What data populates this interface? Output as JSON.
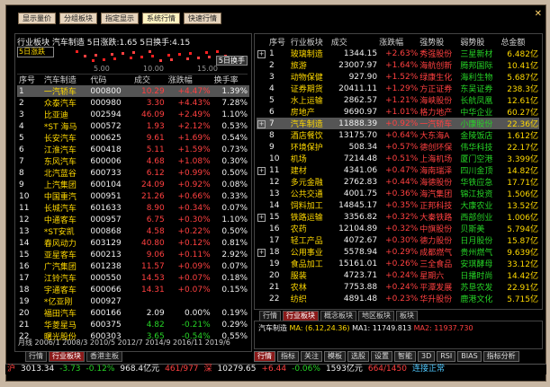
{
  "topbar": {
    "buttons": [
      "显示量价",
      "分组板块",
      "指定显示",
      "系统行情",
      "快速行情"
    ],
    "active_index": 3
  },
  "left": {
    "title": "行业板块 汽车制造 5日涨跌:1.65 5日换手:4.15",
    "mini_box": "5日涨跌",
    "mini_btn": "5日换手",
    "axis_ticks": [
      "5.00",
      "10.00",
      "15.00"
    ],
    "headers": [
      "序号",
      "汽车制造",
      "代码",
      "成交",
      "涨跌幅",
      "换手率"
    ],
    "rows": [
      [
        "1",
        "一汽轿车",
        "000800",
        "10.29",
        "+4.47%",
        "1.39%"
      ],
      [
        "2",
        "众泰汽车",
        "000980",
        "3.30",
        "+4.43%",
        "7.28%"
      ],
      [
        "3",
        "比亚迪",
        "002594",
        "46.09",
        "+2.49%",
        "1.10%"
      ],
      [
        "4",
        "*ST 海马",
        "000572",
        "1.93",
        "+2.12%",
        "0.53%"
      ],
      [
        "5",
        "长安汽车",
        "000625",
        "9.61",
        "+1.69%",
        "0.54%"
      ],
      [
        "6",
        "江淮汽车",
        "600418",
        "5.11",
        "+1.59%",
        "0.73%"
      ],
      [
        "7",
        "东风汽车",
        "600006",
        "4.68",
        "+1.08%",
        "0.30%"
      ],
      [
        "8",
        "北汽蓝谷",
        "600733",
        "6.12",
        "+0.99%",
        "0.50%"
      ],
      [
        "9",
        "上汽集团",
        "600104",
        "24.09",
        "+0.92%",
        "0.08%"
      ],
      [
        "10",
        "中国重汽",
        "000951",
        "21.26",
        "+0.66%",
        "0.33%"
      ],
      [
        "11",
        "长城汽车",
        "601633",
        "8.90",
        "+0.34%",
        "0.07%"
      ],
      [
        "12",
        "中通客车",
        "000957",
        "6.75",
        "+0.30%",
        "1.10%"
      ],
      [
        "13",
        "*ST安凯",
        "000868",
        "4.58",
        "+0.22%",
        "0.50%"
      ],
      [
        "14",
        "春风动力",
        "603129",
        "40.80",
        "+0.12%",
        "0.81%"
      ],
      [
        "15",
        "亚星客车",
        "600213",
        "9.06",
        "+0.11%",
        "2.92%"
      ],
      [
        "16",
        "广汽集团",
        "601238",
        "11.57",
        "+0.09%",
        "0.07%"
      ],
      [
        "17",
        "江铃汽车",
        "000550",
        "14.53",
        "+0.07%",
        "0.18%"
      ],
      [
        "18",
        "宇通客车",
        "600066",
        "14.31",
        "+0.07%",
        "0.15%"
      ],
      [
        "19",
        "*亿亚刚",
        "000927",
        "",
        "",
        ""
      ],
      [
        "20",
        "福田汽车",
        "600166",
        "2.09",
        "0.00%",
        "0.19%"
      ],
      [
        "21",
        "华菱星马",
        "600375",
        "4.82",
        "-0.21%",
        "0.29%"
      ],
      [
        "22",
        "曙光股份",
        "600303",
        "3.65",
        "-0.54%",
        "0.55%"
      ]
    ],
    "tabs": [
      "行情",
      "行业板块",
      "香港主板"
    ]
  },
  "right": {
    "headers": [
      "序号",
      "行业板块",
      "成交",
      "涨跌幅",
      "强势股",
      "弱势股",
      "总金额"
    ],
    "rows": [
      [
        "1",
        "玻璃制造",
        "1344.15",
        "+2.63%",
        "秀强股份",
        "三星新材",
        "6.482亿"
      ],
      [
        "2",
        "旅游",
        "23007.97",
        "+1.64%",
        "海航创新",
        "腾邦国际",
        "10.41亿"
      ],
      [
        "3",
        "动物保健",
        "927.90",
        "+1.52%",
        "绿康生化",
        "海利生物",
        "5.687亿"
      ],
      [
        "4",
        "证券期货",
        "20411.11",
        "+1.29%",
        "方正证券",
        "东吴证券",
        "238.3亿"
      ],
      [
        "5",
        "水上运输",
        "2862.57",
        "+1.21%",
        "海峡股份",
        "长航凤凰",
        "12.61亿"
      ],
      [
        "6",
        "房地产",
        "9690.97",
        "+1.01%",
        "格力地产",
        "中华企业",
        "60.27亿"
      ],
      [
        "7",
        "汽车制造",
        "11888.39",
        "+0.92%",
        "一汽轿车",
        "小康股份",
        "22.36亿"
      ],
      [
        "8",
        "酒店餐饮",
        "13175.70",
        "+0.64%",
        "大东海A",
        "金陵饭店",
        "1.612亿"
      ],
      [
        "9",
        "环境保护",
        "508.34",
        "+0.57%",
        "德创环保",
        "伟华科技",
        "22.17亿"
      ],
      [
        "10",
        "机场",
        "7214.48",
        "+0.51%",
        "上海机场",
        "厦门空港",
        "3.399亿"
      ],
      [
        "11",
        "建材",
        "4341.06",
        "+0.47%",
        "海南瑞泽",
        "四川金顶",
        "14.82亿"
      ],
      [
        "12",
        "多元金融",
        "2762.83",
        "+0.44%",
        "海德股份",
        "华铁应急",
        "17.71亿"
      ],
      [
        "13",
        "公共交通",
        "4001.75",
        "+0.36%",
        "海汽集团",
        "锦江投资",
        "1.506亿"
      ],
      [
        "14",
        "饲料加工",
        "14845.17",
        "+0.35%",
        "正邦科技",
        "大康农业",
        "13.52亿"
      ],
      [
        "15",
        "铁路运输",
        "3356.82",
        "+0.32%",
        "大秦铁路",
        "西部创业",
        "1.006亿"
      ],
      [
        "16",
        "农药",
        "12104.89",
        "+0.32%",
        "中旗股份",
        "贝斯美",
        "5.794亿"
      ],
      [
        "17",
        "轻工产品",
        "4072.67",
        "+0.30%",
        "德力股份",
        "日月股份",
        "15.87亿"
      ],
      [
        "18",
        "公用事业",
        "5578.94",
        "+0.29%",
        "成都燃气",
        "贵州燃气",
        "9.639亿"
      ],
      [
        "19",
        "食品加工",
        "15161.01",
        "+0.26%",
        "三全食品",
        "安琪酵母",
        "33.12亿"
      ],
      [
        "20",
        "服装",
        "4723.71",
        "+0.24%",
        "星期六",
        "日播时尚",
        "14.42亿"
      ],
      [
        "21",
        "农林",
        "7753.88",
        "+0.24%",
        "平潭发展",
        "苏垦农发",
        "22.91亿"
      ],
      [
        "22",
        "纺织",
        "4891.48",
        "+0.23%",
        "华升股份",
        "鹿港文化",
        "5.715亿"
      ]
    ],
    "plus_rows": [
      1,
      7,
      11,
      15,
      18
    ],
    "tabs": [
      "行情",
      "行业板块",
      "概念板块",
      "地区板块",
      "板块"
    ]
  },
  "kline": {
    "label": "汽车制造",
    "ma_text": "MA: (6.12,24.36)",
    "ma1": "MA1: 11749.813",
    "ma2": "MA2: 11937.730"
  },
  "timeline": "月线 2006/1 2008/3 2010/5 2012/7 2014/9 2016/11 2019/6",
  "toolbar2": [
    "行情",
    "指标",
    "关注",
    "模板",
    "选股",
    "设置",
    "智能",
    "3D",
    "RSI",
    "BIAS",
    "指标分析"
  ],
  "status": {
    "sh_label": "沪",
    "sh_index": "3013.34",
    "sh_change": "-3.73",
    "sh_pct": "-0.12%",
    "sh_amt": "968.4亿元",
    "sh_ratio": "461/977",
    "sz_label": "深",
    "sz_index": "10279.65",
    "sz_change": "+6.44",
    "sz_pct": "-0.06%",
    "sz_amt": "1593亿元",
    "sz_ratio": "664/1450",
    "conn": "连接正常"
  },
  "colors": {
    "up": "#ff4040",
    "down": "#26d326",
    "name": "#ffd900"
  }
}
